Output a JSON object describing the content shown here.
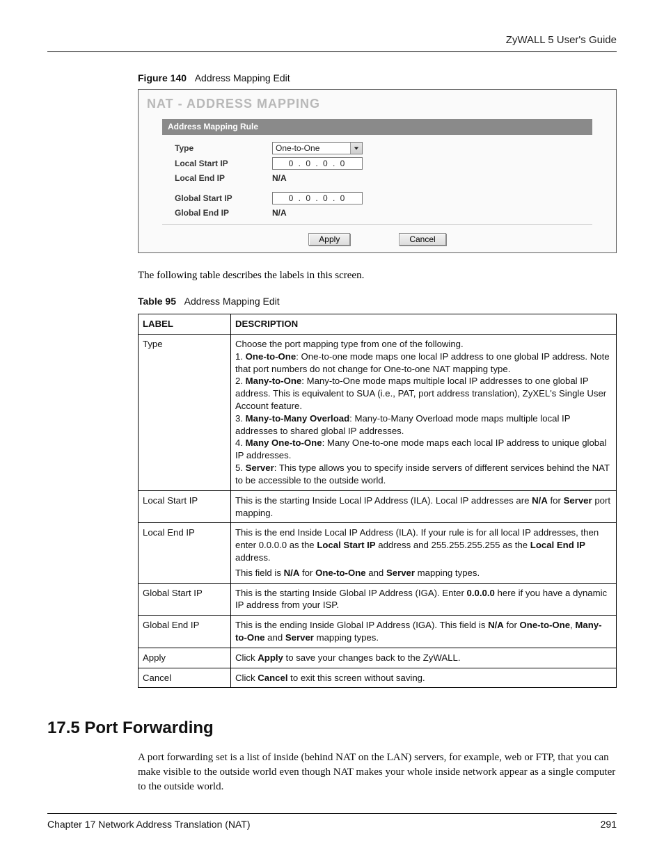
{
  "header": {
    "title": "ZyWALL 5 User's Guide"
  },
  "figure": {
    "number": "Figure 140",
    "title": "Address Mapping Edit",
    "panel_title": "NAT - ADDRESS MAPPING",
    "rule_bar": "Address Mapping Rule",
    "labels": {
      "type": "Type",
      "local_start": "Local Start IP",
      "local_end": "Local End IP",
      "global_start": "Global Start IP",
      "global_end": "Global End IP"
    },
    "values": {
      "type_selected": "One-to-One",
      "local_start_ip": "0   .   0   .   0   .   0",
      "local_end_ip": "N/A",
      "global_start_ip": "0   .   0   .   0   .   0",
      "global_end_ip": "N/A"
    },
    "buttons": {
      "apply": "Apply",
      "cancel": "Cancel"
    }
  },
  "intro_text": "The following table describes the labels in this screen.",
  "table": {
    "number": "Table 95",
    "title": "Address Mapping Edit",
    "headers": {
      "label": "LABEL",
      "desc": "DESCRIPTION"
    },
    "rows": [
      {
        "label": "Type",
        "desc_html": "Choose the port mapping type from one of the following.<br>1. <b>One-to-One</b>: One-to-one mode maps one local IP address to one global IP address. Note that port numbers do not change for One-to-one NAT mapping type.<br>2. <b>Many-to-One</b>: Many-to-One mode maps multiple local IP addresses to one global IP address. This is equivalent to SUA (i.e., PAT, port address translation), ZyXEL's Single User Account feature.<br>3. <b>Many-to-Many Overload</b>: Many-to-Many Overload mode maps multiple local IP addresses to shared global IP addresses.<br>4. <b>Many One-to-One</b>: Many One-to-one mode maps each local IP address to unique global IP addresses.<br>5. <b>Server</b>: This type allows you to specify inside servers of different services behind the NAT to be accessible to the outside world."
      },
      {
        "label": "Local Start IP",
        "desc_html": "This is the starting Inside Local IP Address (ILA). Local IP addresses are <b>N/A</b> for <b>Server</b> port mapping."
      },
      {
        "label": "Local End IP",
        "desc_html": "<p>This is the end Inside Local IP Address (ILA). If your rule is for all local IP addresses, then enter 0.0.0.0 as the <b>Local Start IP</b> address and 255.255.255.255 as the <b>Local End IP</b> address.</p><p>This field is <b>N/A</b> for <b>One-to-One</b> and <b>Server</b> mapping types.</p>"
      },
      {
        "label": "Global Start IP",
        "desc_html": "This is the starting Inside Global IP Address (IGA). Enter <b>0.0.0.0</b> here if you have a dynamic IP address from your ISP."
      },
      {
        "label": "Global End IP",
        "desc_html": "This is the ending Inside Global IP Address (IGA). This field is <b>N/A</b> for <b>One-to-One</b>, <b>Many-to-One</b> and <b>Server</b> mapping types."
      },
      {
        "label": "Apply",
        "desc_html": "Click <b>Apply</b> to save your changes back to the ZyWALL."
      },
      {
        "label": "Cancel",
        "desc_html": "Click <b>Cancel</b> to exit this screen without saving."
      }
    ]
  },
  "section": {
    "heading": "17.5  Port Forwarding",
    "paragraph": "A port forwarding set is a list of inside (behind NAT on the LAN) servers, for example, web or FTP, that you can make visible to the outside world even though NAT makes your whole inside network appear as a single computer to the outside world."
  },
  "footer": {
    "left": "Chapter 17 Network Address Translation (NAT)",
    "right": "291"
  }
}
